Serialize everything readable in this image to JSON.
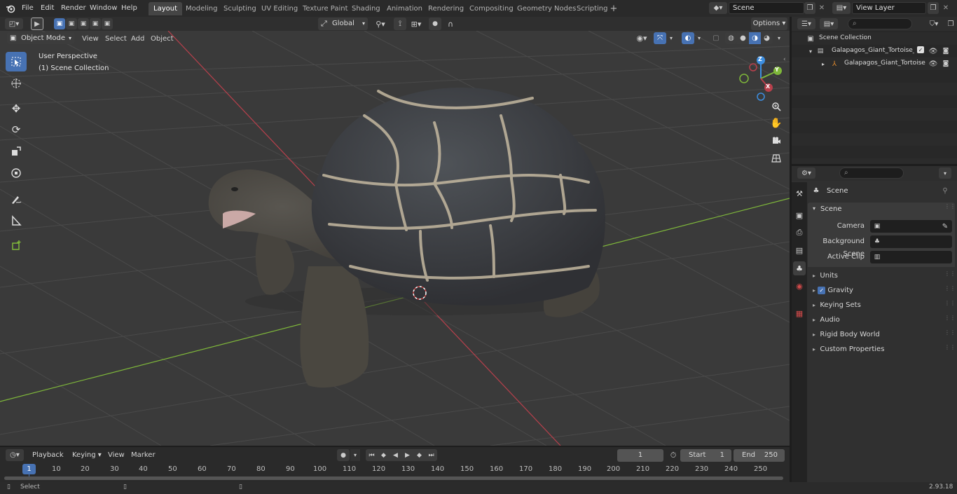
{
  "app": {
    "version": "2.93.18"
  },
  "menubar": {
    "items": [
      "File",
      "Edit",
      "Render",
      "Window",
      "Help"
    ]
  },
  "workspaces": {
    "tabs": [
      "Layout",
      "Modeling",
      "Sculpting",
      "UV Editing",
      "Texture Paint",
      "Shading",
      "Animation",
      "Rendering",
      "Compositing",
      "Geometry Nodes",
      "Scripting"
    ],
    "active": "Layout",
    "add_label": "+"
  },
  "scene": {
    "name": "Scene"
  },
  "view_layer": {
    "name": "View Layer"
  },
  "viewport": {
    "mode": "Object Mode",
    "menus": [
      "View",
      "Select",
      "Add",
      "Object"
    ],
    "transform_orientation": "Global",
    "options_label": "Options",
    "overlay_title": "User Perspective",
    "overlay_subtitle": "(1) Scene Collection",
    "gizmo_axes": {
      "x": "X",
      "y": "Y",
      "z": "Z"
    }
  },
  "outliner": {
    "root": "Scene Collection",
    "items": [
      {
        "label": "Galapagos_Giant_Tortoise_00"
      },
      {
        "label": "Galapagos_Giant_Tortoise"
      }
    ]
  },
  "properties": {
    "context_title": "Scene",
    "section_title": "Scene",
    "fields": [
      {
        "label": "Camera",
        "value": ""
      },
      {
        "label": "Background Scene",
        "value": ""
      },
      {
        "label": "Active Clip",
        "value": ""
      }
    ],
    "panels": [
      "Units",
      "Gravity",
      "Keying Sets",
      "Audio",
      "Rigid Body World",
      "Custom Properties"
    ],
    "gravity_enabled": true
  },
  "timeline": {
    "menus": [
      "Playback",
      "Keying",
      "View",
      "Marker"
    ],
    "current_frame": "1",
    "start_label": "Start",
    "start_value": "1",
    "end_label": "End",
    "end_value": "250",
    "ruler_current": "1",
    "ticks": [
      "10",
      "20",
      "30",
      "40",
      "50",
      "60",
      "70",
      "80",
      "90",
      "100",
      "110",
      "120",
      "130",
      "140",
      "150",
      "160",
      "170",
      "180",
      "190",
      "200",
      "210",
      "220",
      "230",
      "240",
      "250"
    ]
  },
  "statusbar": {
    "left_label": "Select"
  },
  "colors": {
    "accent": "#4772b3",
    "x_axis": "#b8404c",
    "y_axis": "#7fb83a",
    "z_axis": "#3d8ee0",
    "bg_dark": "#1d1d1d",
    "viewport_bg": "#393939"
  }
}
